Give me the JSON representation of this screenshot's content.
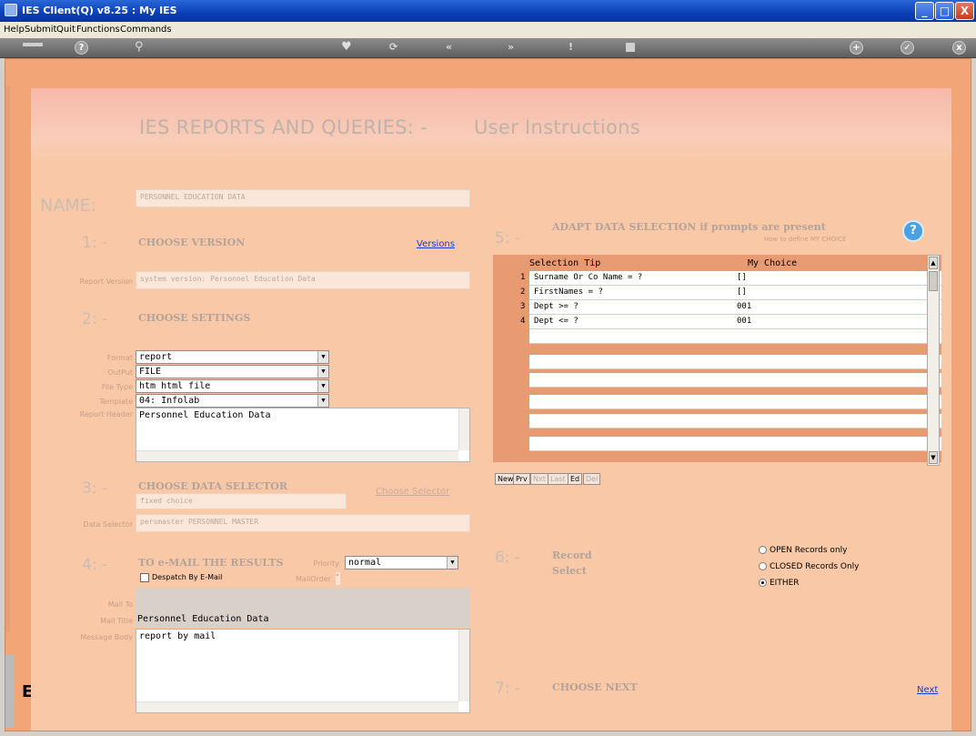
{
  "window": {
    "title": "IES Client(Q) v8.25 : My IES",
    "minimize": "_",
    "maximize": "□",
    "close": "X"
  },
  "menu": [
    "Help",
    "Submit",
    "Quit",
    "Functions",
    "Commands"
  ],
  "toolbar": {
    "help": "?"
  },
  "page": {
    "title_left": "IES REPORTS AND QUERIES: -",
    "title_right": "User Instructions"
  },
  "name": {
    "label": "NAME:",
    "value": "PERSONNEL EDUCATION DATA"
  },
  "section1": {
    "num": "1: -",
    "title": "CHOOSE VERSION",
    "link": "Versions",
    "report_version_label": "Report Version",
    "report_version_value": "system version: Personnel Education Data"
  },
  "section2": {
    "num": "2: -",
    "title": "CHOOSE SETTINGS",
    "format_label": "Format",
    "format_value": "report",
    "output_label": "OutPut",
    "output_value": "FILE",
    "filetype_label": "File Type",
    "filetype_value": "htm html file",
    "template_label": "Template",
    "template_value": "04: Infolab",
    "header_label": "Report Header",
    "header_value": "Personnel Education Data"
  },
  "section3": {
    "num": "3: -",
    "title": "CHOOSE DATA SELECTOR",
    "link": "Choose Selector",
    "fixed_choice": "fixed choice",
    "data_selector_label": "Data Selector",
    "data_selector_value": "persmaster PERSONNEL MASTER"
  },
  "section4": {
    "num": "4: -",
    "title": "TO e-MAIL THE RESULTS",
    "priority_label": "Priority",
    "priority_value": "normal",
    "despatch_label": "Despatch By E-Mail",
    "mailorder_label": "MailOrder",
    "mailorder_value": "*",
    "mailto_label": "Mail To",
    "mailtitle_label": "Mail Title",
    "mailtitle_value": "Personnel Education Data",
    "body_label": "Message Body",
    "body_value": "report by mail"
  },
  "section5": {
    "num": "5: -",
    "title": "ADAPT DATA SELECTION if prompts are present",
    "howto": "How to define MY CHOICE",
    "help_icon": "?",
    "col_tip": "Selection Tip",
    "col_choice": "My Choice",
    "rows": [
      {
        "n": "1",
        "tip": "Surname Or Co Name = ?",
        "choice": "[]"
      },
      {
        "n": "2",
        "tip": "FirstNames = ?",
        "choice": "[]"
      },
      {
        "n": "3",
        "tip": "Dept >= ?",
        "choice": "001"
      },
      {
        "n": "4",
        "tip": "Dept <= ?",
        "choice": "001"
      }
    ],
    "buttons": [
      "New",
      "Prv",
      "Nxt",
      "Last",
      "Ed",
      "Del"
    ]
  },
  "section6": {
    "num": "6: -",
    "title_line1": "Record",
    "title_line2": "Select",
    "options": [
      "OPEN Records only",
      "CLOSED Records Only",
      "EITHER"
    ]
  },
  "section7": {
    "num": "7: -",
    "title": "CHOOSE NEXT",
    "link": "Next"
  },
  "sidebar": {
    "letter": "E"
  }
}
